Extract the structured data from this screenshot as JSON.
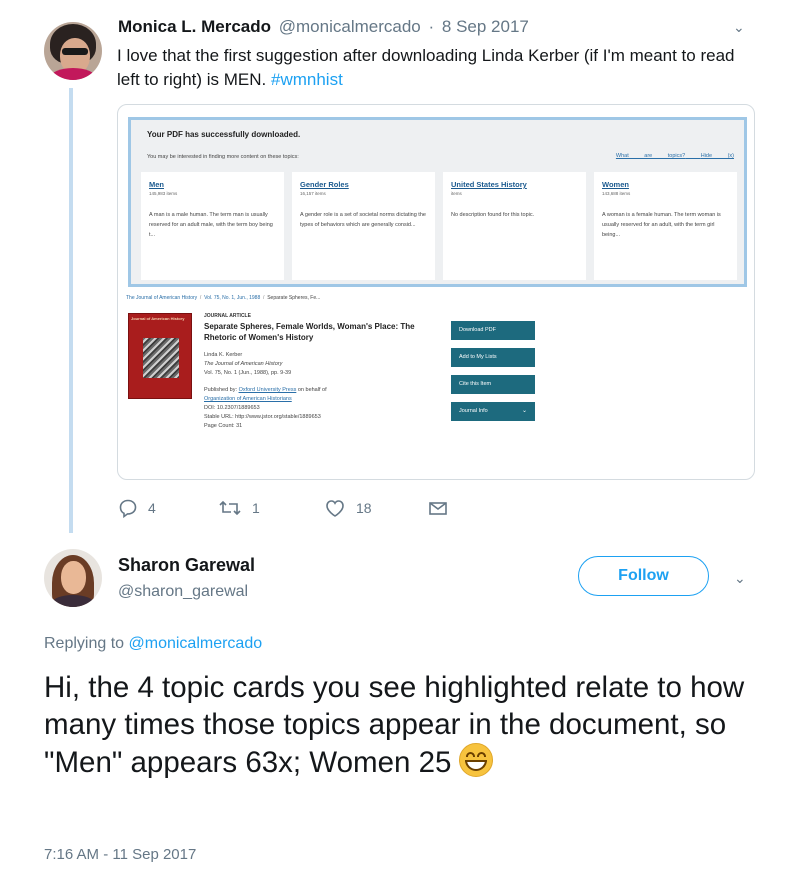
{
  "tweet1": {
    "name": "Monica L. Mercado",
    "handle": "@monicalmercado",
    "separator": "·",
    "date": "8 Sep 2017",
    "text_before": "I love that the first suggestion after downloading Linda Kerber (if I'm meant to read left to right) is MEN. ",
    "hashtag": "#wmnhist",
    "reply_count": "4",
    "retweet_count": "1",
    "like_count": "18"
  },
  "embed": {
    "pdf_title": "Your PDF has successfully downloaded.",
    "pdf_sub": "You may be interested in finding more content on these topics:",
    "link_what": "What are topics?",
    "link_hide": "Hide (x)",
    "cards": [
      {
        "title": "Men",
        "count": "145,983 items",
        "desc": "A man is a male human. The term man is usually reserved for an adult male, with the term boy being t..."
      },
      {
        "title": "Gender Roles",
        "count": "16,157 items",
        "desc": "A gender role is a set of societal norms dictating the types of behaviors which are generally consid..."
      },
      {
        "title": "United States History",
        "count": "items",
        "desc": "No description found for this topic."
      },
      {
        "title": "Women",
        "count": "143,688 items",
        "desc": "A woman is a female human. The term woman is usually reserved for an adult, with the term girl being..."
      }
    ],
    "breadcrumb": {
      "journal": "The Journal of American History",
      "sep": "/",
      "issue": "Vol. 75, No. 1, Jun., 1988",
      "article": "Separate Spheres, Fe..."
    },
    "cover_title": "Journal of American History",
    "article": {
      "type": "JOURNAL ARTICLE",
      "title": "Separate Spheres, Female Worlds, Woman's Place: The Rhetoric of Women's History",
      "author": "Linda K. Kerber",
      "journal": "The Journal of American History",
      "volume": "Vol. 75, No. 1 (Jun., 1988), pp. 9-39",
      "published_by": "Published by:",
      "publisher": "Oxford University Press",
      "on_behalf": "on behalf of",
      "org": "Organization of American Historians",
      "doi": "DOI: 10.2307/1889653",
      "stable_url": "Stable URL: http://www.jstor.org/stable/1889653",
      "page_count": "Page Count: 31"
    },
    "buttons": {
      "download": "Download PDF",
      "add": "Add to My Lists",
      "cite": "Cite this Item",
      "journal_info": "Journal Info",
      "chevron": "⌄"
    }
  },
  "tweet2": {
    "name": "Sharon Garewal",
    "handle": "@sharon_garewal",
    "follow_label": "Follow",
    "replying_to_label": "Replying to",
    "replying_to_mention": "@monicalmercado",
    "text": "Hi, the 4 topic cards you see highlighted relate to how many times those topics appear in the document, so \"Men\" appears 63x; Women 25",
    "emoji": "grinning-face-emoji",
    "timestamp": "7:16 AM - 11 Sep 2017"
  },
  "caret_glyph": "⌄",
  "colors": {
    "accent": "#1da1f2",
    "text": "#14171a",
    "muted": "#657786",
    "thread_line": "#c4dcf0",
    "jstor_button": "#1d6a7e"
  }
}
